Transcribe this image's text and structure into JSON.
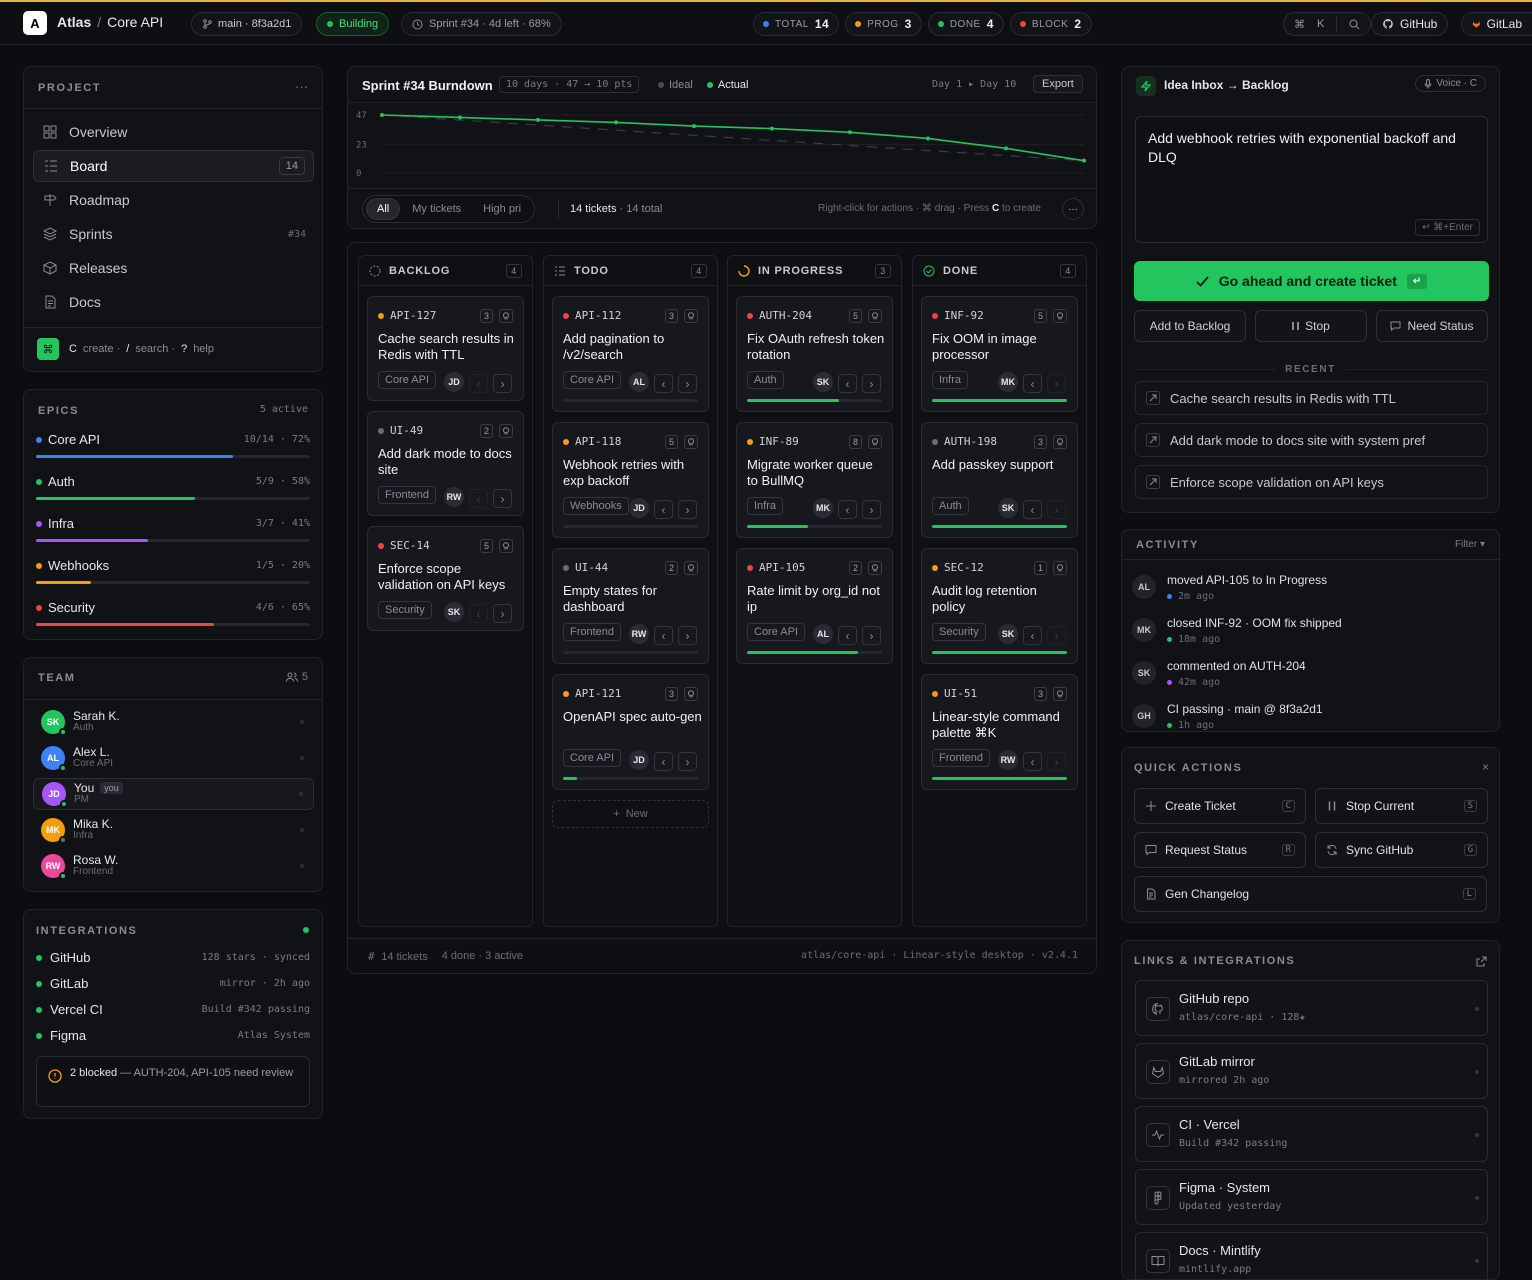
{
  "topbar": {
    "logo": "A",
    "app": "Atlas",
    "sep": "/",
    "project": "Core API",
    "branch": "main · 8f3a2d1",
    "build": "Building",
    "sprint": "Sprint #34 · 4d left · 68%",
    "stats": [
      {
        "label": "TOTAL",
        "value": "14",
        "color": "#3b82f6"
      },
      {
        "label": "PROG",
        "value": "3",
        "color": "#f59e0b"
      },
      {
        "label": "DONE",
        "value": "4",
        "color": "#22c55e"
      },
      {
        "label": "BLOCK",
        "value": "2",
        "color": "#ef4444"
      }
    ],
    "cmd_key": "K",
    "github": "GitHub",
    "gitlab": "GitLab"
  },
  "project": {
    "title": "PROJECT",
    "more": "···",
    "nav": [
      {
        "label": "Overview",
        "icon": "grid-icon"
      },
      {
        "label": "Board",
        "icon": "board-icon",
        "badge": "14"
      },
      {
        "label": "Roadmap",
        "icon": "signpost-icon"
      },
      {
        "label": "Sprints",
        "icon": "layers-icon",
        "badge": "#34"
      },
      {
        "label": "Releases",
        "icon": "box-icon"
      },
      {
        "label": "Docs",
        "icon": "doc-icon"
      }
    ],
    "hint": {
      "k1": "C",
      "t1": "create ·",
      "k2": "/",
      "t2": "search ·",
      "k3": "?",
      "t3": "help"
    }
  },
  "epics": {
    "title": "EPICS",
    "active": "5 active",
    "items": [
      {
        "name": "Core API",
        "stat": "10/14 · 72%",
        "progress": 0.72,
        "color": "#3b82f6"
      },
      {
        "name": "Auth",
        "stat": "5/9 · 58%",
        "progress": 0.58,
        "color": "#22c55e"
      },
      {
        "name": "Infra",
        "stat": "3/7 · 41%",
        "progress": 0.41,
        "color": "#a855f7"
      },
      {
        "name": "Webhooks",
        "stat": "1/5 · 20%",
        "progress": 0.2,
        "color": "#f59e0b"
      },
      {
        "name": "Security",
        "stat": "4/6 · 65%",
        "progress": 0.65,
        "color": "#ef4444"
      }
    ]
  },
  "team": {
    "title": "TEAM",
    "count": "5",
    "members": [
      {
        "initials": "SK",
        "name": "Sarah K.",
        "role": "Auth",
        "color": "#22c55e",
        "status": "#22c55e"
      },
      {
        "initials": "AL",
        "name": "Alex L.",
        "role": "Core API",
        "color": "#3b82f6",
        "status": "#22c55e"
      },
      {
        "initials": "JD",
        "name": "You",
        "you": "you",
        "role": "PM",
        "color": "#a855f7",
        "status": "#22c55e"
      },
      {
        "initials": "MK",
        "name": "Mika K.",
        "role": "Infra",
        "color": "#f59e0b",
        "status": "#6b6d75"
      },
      {
        "initials": "RW",
        "name": "Rosa W.",
        "role": "Frontend",
        "color": "#ec4899",
        "status": "#22c55e"
      }
    ]
  },
  "integrations": {
    "title": "INTEGRATIONS",
    "items": [
      {
        "name": "GitHub",
        "meta": "128 stars · synced"
      },
      {
        "name": "GitLab",
        "meta": "mirror · 2h ago"
      },
      {
        "name": "Vercel CI",
        "meta": "Build #342 passing"
      },
      {
        "name": "Figma",
        "meta": "Atlas System"
      }
    ],
    "alert_bold": "2 blocked",
    "alert_text": " — AUTH-204, API-105 need review"
  },
  "burndown": {
    "title": "Sprint #34 Burndown",
    "meta": "10 days · 47 → 10 pts",
    "legend_ideal": "Ideal",
    "legend_actual": "Actual",
    "range": "Day 1 ▸ Day 10",
    "export": "Export",
    "ticks": [
      "47",
      "23",
      "0"
    ],
    "filters": [
      "All",
      "My tickets",
      "High pri"
    ],
    "count": "14 tickets",
    "total": "· 14 total",
    "hint": "Right-click for actions · ⌘ drag · Press",
    "hint_key": "C",
    "hint_end": "to create"
  },
  "chart_data": {
    "type": "line",
    "ylim": [
      0,
      47
    ],
    "x": [
      1,
      2,
      3,
      4,
      5,
      6,
      7,
      8,
      9,
      10
    ],
    "series": [
      {
        "name": "Ideal",
        "values": [
          47,
          42.9,
          38.8,
          34.7,
          30.6,
          26.4,
          22.3,
          18.2,
          14.1,
          10
        ]
      },
      {
        "name": "Actual",
        "values": [
          47,
          45,
          43,
          41,
          38,
          36,
          33,
          28,
          20,
          10
        ]
      }
    ]
  },
  "board": {
    "columns": [
      {
        "name": "BACKLOG",
        "count": "4",
        "icon": "circle-dashed-icon",
        "cards": [
          {
            "id": "API-127",
            "pts": "3",
            "dot": "#f59e0b",
            "title": "Cache search results in Redis with TTL",
            "tag": "Core API",
            "av": "JD"
          },
          {
            "id": "UI-49",
            "pts": "2",
            "dot": "#6b6d75",
            "title": "Add dark mode to docs site",
            "tag": "Frontend",
            "av": "RW"
          },
          {
            "id": "SEC-14",
            "pts": "5",
            "dot": "#ef4444",
            "title": "Enforce scope validation on API keys",
            "tag": "Security",
            "av": "SK"
          }
        ]
      },
      {
        "name": "TODO",
        "count": "4",
        "icon": "list-icon",
        "cards": [
          {
            "id": "API-112",
            "pts": "3",
            "dot": "#ef4444",
            "title": "Add pagination to /v2/search",
            "tag": "Core API",
            "av": "AL",
            "progress": 0
          },
          {
            "id": "API-118",
            "pts": "5",
            "dot": "#f59e0b",
            "title": "Webhook retries with exp backoff",
            "tag": "Webhooks",
            "av": "JD",
            "progress": 0
          },
          {
            "id": "UI-44",
            "pts": "2",
            "dot": "#6b6d75",
            "title": "Empty states for dashboard",
            "tag": "Frontend",
            "av": "RW",
            "progress": 0
          },
          {
            "id": "API-121",
            "pts": "3",
            "dot": "#f59e0b",
            "title": "OpenAPI spec auto-gen",
            "tag": "Core API",
            "av": "JD",
            "progress": 0.1
          }
        ],
        "new": "New"
      },
      {
        "name": "IN PROGRESS",
        "count": "3",
        "icon": "spinner-icon",
        "cards": [
          {
            "id": "AUTH-204",
            "pts": "5",
            "dot": "#ef4444",
            "title": "Fix OAuth refresh token rotation",
            "tag": "Auth",
            "av": "SK",
            "progress": 0.68
          },
          {
            "id": "INF-89",
            "pts": "8",
            "dot": "#f59e0b",
            "title": "Migrate worker queue to BullMQ",
            "tag": "Infra",
            "av": "MK",
            "progress": 0.45
          },
          {
            "id": "API-105",
            "pts": "2",
            "dot": "#ef4444",
            "title": "Rate limit by org_id not ip",
            "tag": "Core API",
            "av": "AL",
            "progress": 0.82
          }
        ]
      },
      {
        "name": "DONE",
        "count": "4",
        "icon": "check-circle-icon",
        "cards": [
          {
            "id": "INF-92",
            "pts": "5",
            "dot": "#ef4444",
            "title": "Fix OOM in image processor",
            "tag": "Infra",
            "av": "MK",
            "progress": 1
          },
          {
            "id": "AUTH-198",
            "pts": "3",
            "dot": "#6b6d75",
            "title": "Add passkey support",
            "tag": "Auth",
            "av": "SK",
            "progress": 1
          },
          {
            "id": "SEC-12",
            "pts": "1",
            "dot": "#f59e0b",
            "title": "Audit log retention policy",
            "tag": "Security",
            "av": "SK",
            "progress": 1
          },
          {
            "id": "UI-51",
            "pts": "3",
            "dot": "#f59e0b",
            "title": "Linear-style command palette ⌘K",
            "tag": "Frontend",
            "av": "RW",
            "progress": 1
          }
        ]
      }
    ],
    "footer": {
      "tickets": "14 tickets",
      "status": "4 done · 3 active",
      "right": "atlas/core-api · Linear-style desktop · v2.4.1"
    }
  },
  "inbox": {
    "title": "Idea Inbox → Backlog",
    "voice": "Voice · C",
    "text": "Add webhook retries with exponential backoff and DLQ",
    "submit_hint": "⌘+Enter",
    "go": "Go ahead and create ticket",
    "add": "Add to Backlog",
    "stop": "Stop",
    "need": "Need Status",
    "recent_title": "RECENT",
    "recent": [
      "Cache search results in Redis with TTL",
      "Add dark mode to docs site with system pref",
      "Enforce scope validation on API keys"
    ]
  },
  "activity": {
    "title": "ACTIVITY",
    "filter": "Filter ▾",
    "items": [
      {
        "who": "AL",
        "text": "moved API-105 to In Progress",
        "time": "2m ago",
        "color": "#3b82f6"
      },
      {
        "who": "MK",
        "text": "closed INF-92 · OOM fix shipped",
        "time": "18m ago",
        "color": "#22c55e"
      },
      {
        "who": "SK",
        "text": "commented on AUTH-204",
        "time": "42m ago",
        "color": "#a855f7"
      },
      {
        "who": "GH",
        "text": "CI passing · main @ 8f3a2d1",
        "time": "1h ago",
        "color": "#22c55e"
      }
    ]
  },
  "quick": {
    "title": "QUICK ACTIONS",
    "close": "×",
    "items": [
      {
        "label": "Create Ticket",
        "key": "C",
        "icon": "plus-icon"
      },
      {
        "label": "Stop Current",
        "key": "S",
        "icon": "pause-icon"
      },
      {
        "label": "Request Status",
        "key": "R",
        "icon": "chat-icon"
      },
      {
        "label": "Sync GitHub",
        "key": "G",
        "icon": "sync-icon"
      },
      {
        "label": "Gen Changelog",
        "key": "L",
        "icon": "doc-icon"
      }
    ]
  },
  "links": {
    "title": "LINKS & INTEGRATIONS",
    "items": [
      {
        "title": "GitHub repo",
        "sub": "atlas/core-api · 128★",
        "icon": "github-icon"
      },
      {
        "title": "GitLab mirror",
        "sub": "mirrored 2h ago",
        "icon": "gitlab-icon"
      },
      {
        "title": "CI · Vercel",
        "sub": "Build #342 passing",
        "icon": "pulse-icon"
      },
      {
        "title": "Figma · System",
        "sub": "Updated yesterday",
        "icon": "figma-icon"
      },
      {
        "title": "Docs · Mintlify",
        "sub": "mintlify.app",
        "icon": "book-icon"
      }
    ]
  }
}
